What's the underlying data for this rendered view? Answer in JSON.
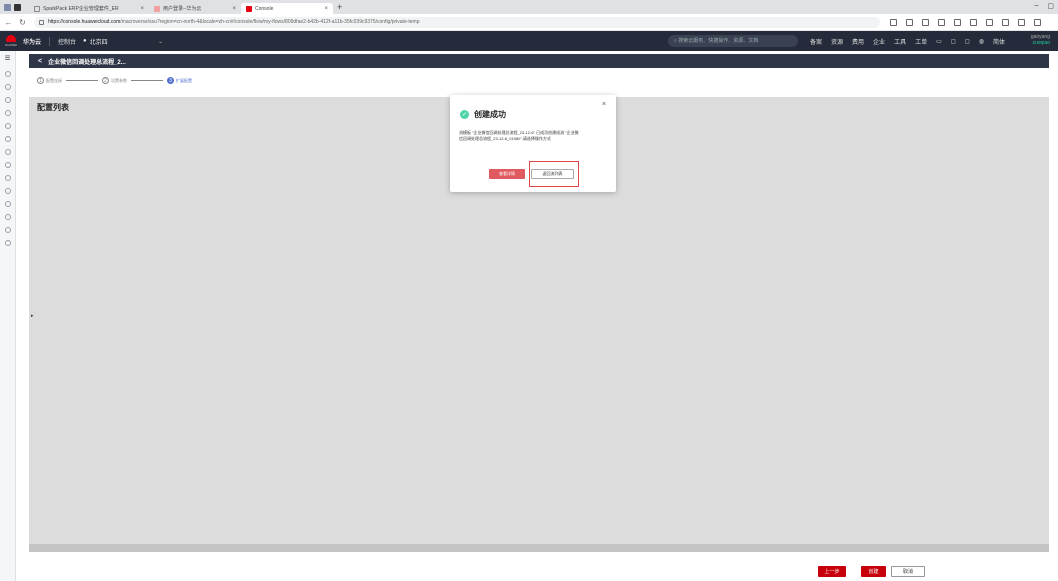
{
  "browser": {
    "tabs": [
      {
        "label": "SparkPack ERP企业管理套件_ER",
        "active": false
      },
      {
        "label": "用户登录--华为云",
        "active": false
      },
      {
        "label": "Console",
        "active": true
      }
    ],
    "new_tab": "+",
    "url_host": "https://console.huaweicloud.com",
    "url_path": "/macroverse/ssu?region=cn-north-4&locale=zh-cn#/console/flow/my-flows/809dfae2-b42b-412f-a11b-35fc039c9375/config/private-temp",
    "window_controls": [
      "–",
      "▢"
    ]
  },
  "topnav": {
    "logo_text": "HUAWEI",
    "brand": "华为云",
    "console": "控制台",
    "region": "北京四",
    "search_placeholder": "搜索云服务、快捷操作、资源、文档",
    "menu": [
      "备案",
      "资源",
      "费用",
      "企业",
      "工具",
      "工单"
    ],
    "lang": "简体",
    "username_top": "gaoyang",
    "username_bottom": "zuoqiao"
  },
  "subheader": {
    "back": "<",
    "title": "企业微信回调处理总流程_2..."
  },
  "steps": [
    {
      "num": "1",
      "label": "配置连接"
    },
    {
      "num": "2",
      "label": "设置参数"
    },
    {
      "num": "3",
      "label": "扩展配置"
    }
  ],
  "content": {
    "title": "配置列表"
  },
  "footer": {
    "prev": "上一步",
    "create": "创建",
    "cancel": "取消"
  },
  "modal": {
    "title": "创建成功",
    "close": "×",
    "body": "流模板 \"企业微信回调处理总流程_23-12-6\" 已成功创建成流 \"企业微信回调处理总流程_23-12-6_01980\",请选择操作方式",
    "btn_detail": "查看详情",
    "btn_back": "返回流列表"
  },
  "colors": {
    "accent_red": "#c7000b",
    "nav_dark": "#252b3a",
    "success": "#50d4ab",
    "step_active": "#526ecc"
  }
}
